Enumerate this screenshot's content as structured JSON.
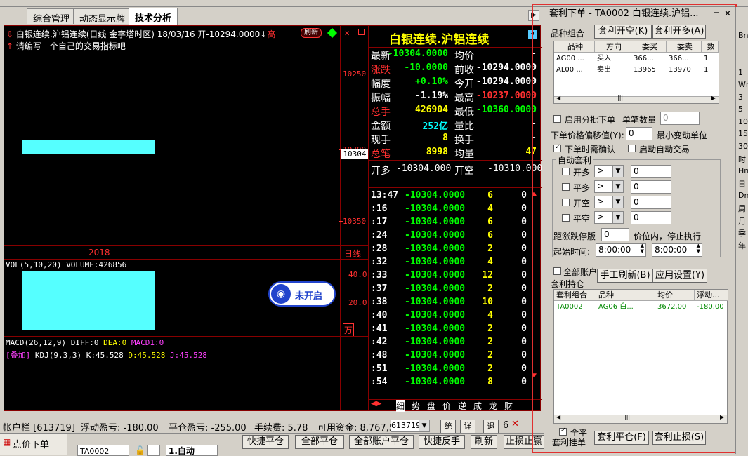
{
  "tabs": [
    "综合管理",
    "动态显示牌",
    "技术分析"
  ],
  "chart": {
    "header": "白银连续.沪铝连续(日线 金字塔时区) 18/03/16 开-10294.0000",
    "hint": "请编写一个自己的交易指标吧",
    "high_label": "高",
    "refresh_btn": "刷新",
    "y_labels": [
      "10250",
      "10300",
      "10350"
    ],
    "price_tag": "10304",
    "year_label": "2018",
    "period_label": "日线",
    "vol_label": "VOL(5,10,20) VOLUME:426856",
    "vol_axis": [
      "40.0",
      "20.0"
    ],
    "vol_unit": "万",
    "not_enabled": "未开启",
    "macd_label": "MACD(26,12,9)",
    "diff": "DIFF:0",
    "dea": "DEA:0",
    "macd1": "MACD1:0",
    "overlay_tag": "[叠加]",
    "kdj_label": "KDJ(9,3,3)",
    "k": "K:45.528",
    "d": "D:45.528",
    "j": "J:45.528"
  },
  "quote": {
    "title": "白银连续.沪铝连续",
    "rows": [
      [
        "最新",
        "-10304.0000",
        "均价",
        "-"
      ],
      [
        "涨跌",
        "-10.0000",
        "前收",
        "-10294.0000"
      ],
      [
        "幅度",
        "+0.10%",
        "今开",
        "-10294.0000"
      ],
      [
        "振幅",
        "-1.19%",
        "最高",
        "-10237.0000"
      ],
      [
        "总手",
        "426904",
        "最低",
        "-10360.0000"
      ],
      [
        "金额",
        "252亿",
        "量比",
        "-"
      ],
      [
        "现手",
        "8",
        "换手",
        "-"
      ],
      [
        "总笔",
        "8998",
        "均量",
        "47"
      ]
    ],
    "open_long_label": "开多",
    "open_long": "-10304.000",
    "open_short_label": "开空",
    "open_short": "-10310.000",
    "ticks": [
      [
        "13:47",
        "-10304.0000",
        "6",
        "0"
      ],
      [
        ":16",
        "-10304.0000",
        "4",
        "0"
      ],
      [
        ":17",
        "-10304.0000",
        "6",
        "0"
      ],
      [
        ":24",
        "-10304.0000",
        "6",
        "0"
      ],
      [
        ":28",
        "-10304.0000",
        "2",
        "0"
      ],
      [
        ":32",
        "-10304.0000",
        "4",
        "0"
      ],
      [
        ":33",
        "-10304.0000",
        "12",
        "0"
      ],
      [
        ":37",
        "-10304.0000",
        "2",
        "0"
      ],
      [
        ":38",
        "-10304.0000",
        "10",
        "0"
      ],
      [
        ":40",
        "-10304.0000",
        "4",
        "0"
      ],
      [
        ":41",
        "-10304.0000",
        "2",
        "0"
      ],
      [
        ":42",
        "-10304.0000",
        "2",
        "0"
      ],
      [
        ":48",
        "-10304.0000",
        "2",
        "0"
      ],
      [
        ":51",
        "-10304.0000",
        "2",
        "0"
      ],
      [
        ":54",
        "-10304.0000",
        "8",
        "0"
      ]
    ],
    "bottom_tabs": [
      "细",
      "势",
      "盘",
      "价",
      "逆",
      "成",
      "龙",
      "财"
    ]
  },
  "status": {
    "account": "帐户栏 [613719]",
    "float_pl": "浮动盈亏: -180.00",
    "close_pl": "平仓盈亏: -255.00",
    "fee": "手续费: 5.78",
    "funds": "可用资金: 8,767,5",
    "account_sel": "613719",
    "btn1": "统",
    "btn2": "详",
    "btn3": "退",
    "tail": "6"
  },
  "bottom": {
    "tab": "点价下单",
    "code": "TA0002",
    "mode": "1.自动",
    "buttons": [
      "快捷平仓",
      "全部平仓",
      "全部账户平仓",
      "快捷反手",
      "刷新",
      "止损止赢"
    ]
  },
  "panel": {
    "title": "套利下单 - TA0002 白银连续.沪铝...",
    "combo_label": "品种组合",
    "btn_open_short": "套利开空(K)",
    "btn_open_long": "套利开多(A)",
    "grid_headers": [
      "品种",
      "方向",
      "委买",
      "委卖",
      "数"
    ],
    "grid_rows": [
      [
        "AG00 ...",
        "买入",
        "366...",
        "366...",
        "1"
      ],
      [
        "AL00 ...",
        "卖出",
        "13965",
        "13970",
        "1"
      ]
    ],
    "batch_label": "启用分批下单",
    "qty_label": "单笔数量",
    "qty": "0",
    "offset_label": "下单价格偏移值(Y):",
    "offset": "0",
    "min_unit": "最小变动单位",
    "confirm_label": "下单时需确认",
    "auto_trade": "启动自动交易",
    "auto_arb": "自动套利",
    "arb_rows": [
      [
        "开多",
        ">",
        "0"
      ],
      [
        "平多",
        ">",
        "0"
      ],
      [
        "开空",
        ">",
        "0"
      ],
      [
        "平空",
        ">",
        "0"
      ]
    ],
    "limit_label": "距涨跌停版",
    "limit_val": "0",
    "limit_suffix": "价位内，停止执行",
    "start_label": "起始时间:",
    "start_time": "8:00:00",
    "end_time": "8:00:00",
    "all_accounts": "全部账户",
    "manual_refresh": "手工刷新(B)",
    "apply_settings": "应用设置(Y)",
    "holdings_label": "套利持仓",
    "hold_headers": [
      "套利组合",
      "品种",
      "均价",
      "浮动..."
    ],
    "hold_rows": [
      [
        "TA0002",
        "AG06 白...",
        "3672.00",
        "-180.00"
      ]
    ],
    "full_close": "全平",
    "arb_order": "套利挂单",
    "btn_close": "套利平仓(F)",
    "btn_stop": "套利止损(S)"
  },
  "sidebar": [
    "Bn",
    "",
    "",
    "1",
    "Wn",
    "3",
    "5",
    "10",
    "15",
    "30",
    "时",
    "Hn",
    "日",
    "Dn",
    "周",
    "月",
    "季",
    "年"
  ]
}
